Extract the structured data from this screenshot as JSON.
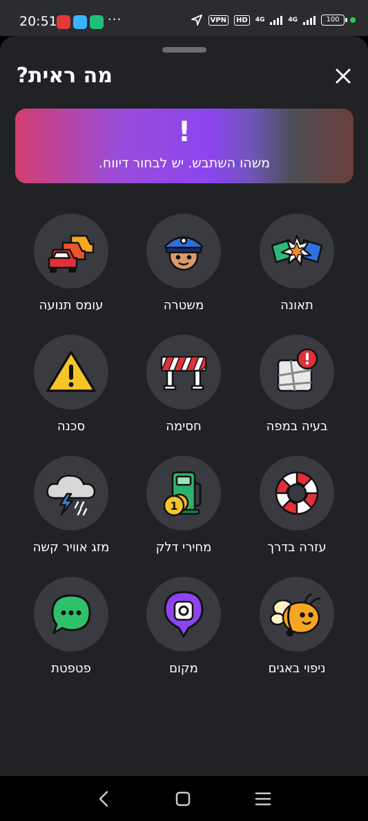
{
  "status_bar": {
    "time": "20:51",
    "more": "···",
    "vpn": "VPN",
    "hd": "HD",
    "net1": "4G",
    "net2": "4G",
    "battery": "100"
  },
  "sheet": {
    "title": "מה ראית?",
    "banner": {
      "icon": "!",
      "text": "משהו השתבש. יש לבחור דיווח."
    },
    "items": [
      {
        "label": "עומס תנועה",
        "icon": "traffic-jam-icon"
      },
      {
        "label": "משטרה",
        "icon": "police-icon"
      },
      {
        "label": "תאונה",
        "icon": "accident-icon"
      },
      {
        "label": "סכנה",
        "icon": "hazard-icon"
      },
      {
        "label": "חסימה",
        "icon": "road-closure-icon"
      },
      {
        "label": "בעיה במפה",
        "icon": "map-issue-icon"
      },
      {
        "label": "מזג אוויר קשה",
        "icon": "bad-weather-icon"
      },
      {
        "label": "מחירי דלק",
        "icon": "fuel-price-icon"
      },
      {
        "label": "עזרה בדרך",
        "icon": "roadside-help-icon"
      },
      {
        "label": "פטפטת",
        "icon": "chat-icon"
      },
      {
        "label": "מקום",
        "icon": "place-icon"
      },
      {
        "label": "ניפוי באגים",
        "icon": "debug-bee-icon"
      }
    ]
  },
  "colors": {
    "sheet_bg": "#212226",
    "circle_bg": "#393b40",
    "accent_purple": "#8b45ee"
  }
}
